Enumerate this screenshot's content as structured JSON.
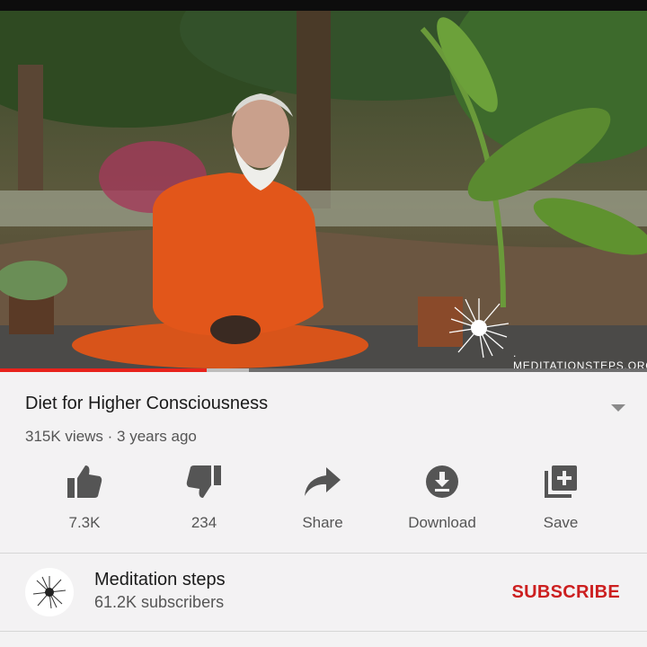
{
  "video": {
    "watermark_text": ". MEDITATIONSTEPS.ORG",
    "progress_fraction": 0.32,
    "buffer_fraction": 0.385
  },
  "info": {
    "title": "Diet for Higher Consciousness",
    "meta": "315K views · 3 years ago"
  },
  "actions": [
    {
      "label": "7.3K",
      "icon": "thumbs-up-icon"
    },
    {
      "label": "234",
      "icon": "thumbs-down-icon"
    },
    {
      "label": "Share",
      "icon": "share-icon"
    },
    {
      "label": "Download",
      "icon": "download-icon"
    },
    {
      "label": "Save",
      "icon": "save-playlist-icon"
    }
  ],
  "channel": {
    "name": "Meditation steps",
    "subscribers": "61.2K subscribers",
    "subscribe_label": "SUBSCRIBE"
  },
  "colors": {
    "accent": "#cc1f1f",
    "progress": "#e8231c",
    "robe": "#e2561a"
  }
}
